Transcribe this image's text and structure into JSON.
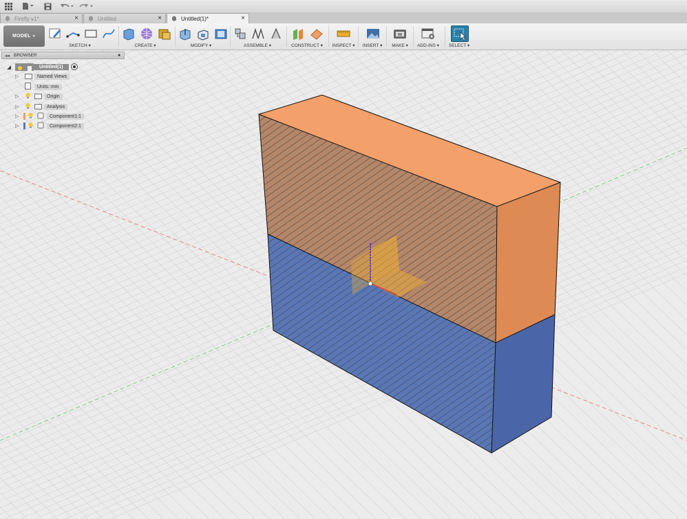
{
  "quickbar": {
    "app_menu_icon": "grid-icon",
    "file_icon": "file-icon",
    "save_icon": "save-icon",
    "undo_icon": "undo-icon",
    "redo_icon": "redo-icon"
  },
  "tabs": [
    {
      "label": "Firefly v1*",
      "active": false
    },
    {
      "label": "Untitled",
      "active": false
    },
    {
      "label": "Untitled(1)*",
      "active": true
    }
  ],
  "ribbon": {
    "workspace": "MODEL",
    "groups": [
      {
        "label": "SKETCH"
      },
      {
        "label": "CREATE"
      },
      {
        "label": "MODIFY"
      },
      {
        "label": "ASSEMBLE"
      },
      {
        "label": "CONSTRUCT"
      },
      {
        "label": "INSPECT"
      },
      {
        "label": "INSERT"
      },
      {
        "label": "MAKE"
      },
      {
        "label": "ADD-INS"
      },
      {
        "label": "SELECT"
      }
    ]
  },
  "browser": {
    "title": "BROWSER",
    "root": "Untitled(1)",
    "items": [
      {
        "label": "Named Views"
      },
      {
        "label": "Units: mm"
      },
      {
        "label": "Origin"
      },
      {
        "label": "Analysis"
      },
      {
        "label": "Component1:1"
      },
      {
        "label": "Component2:1"
      }
    ]
  },
  "colors": {
    "component1": "#f0a06a",
    "component2": "#5a77b4",
    "axis_x": "#e05050",
    "axis_y": "#3aa84a",
    "select_accent": "#2b7fa8"
  }
}
